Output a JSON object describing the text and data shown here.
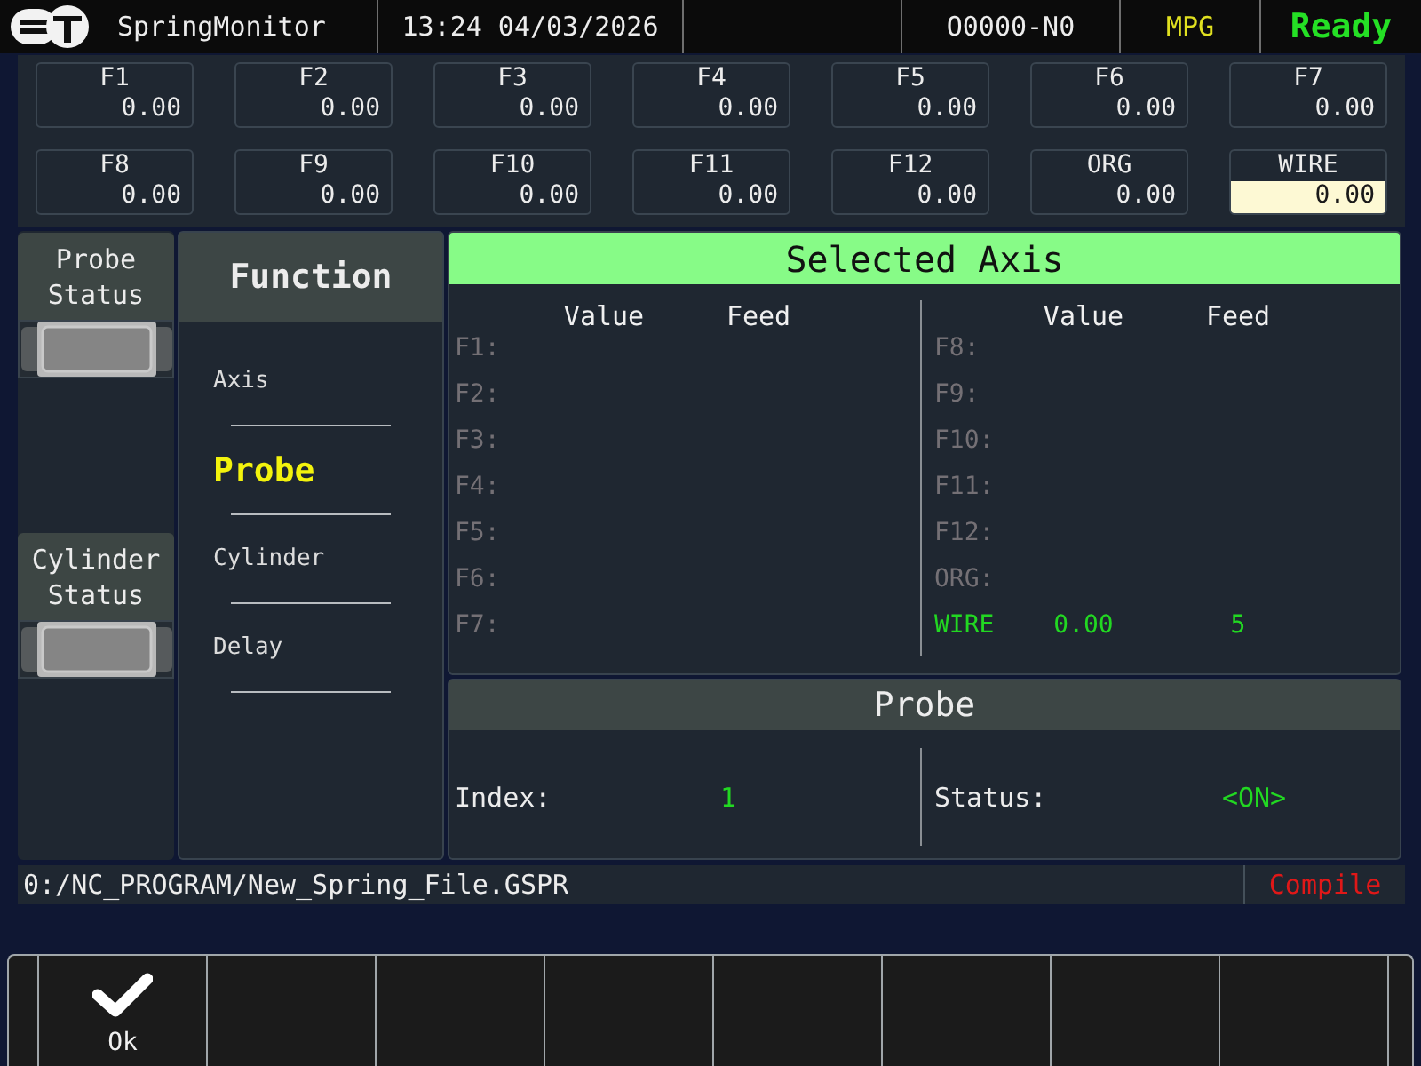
{
  "header": {
    "title": "SpringMonitor",
    "datetime": "13:24 04/03/2026",
    "program": "O0000-N0",
    "mode": "MPG",
    "state": "Ready"
  },
  "axes": [
    {
      "label": "F1",
      "value": "0.00",
      "selected": false
    },
    {
      "label": "F2",
      "value": "0.00",
      "selected": false
    },
    {
      "label": "F3",
      "value": "0.00",
      "selected": false
    },
    {
      "label": "F4",
      "value": "0.00",
      "selected": false
    },
    {
      "label": "F5",
      "value": "0.00",
      "selected": false
    },
    {
      "label": "F6",
      "value": "0.00",
      "selected": false
    },
    {
      "label": "F7",
      "value": "0.00",
      "selected": false
    },
    {
      "label": "F8",
      "value": "0.00",
      "selected": false
    },
    {
      "label": "F9",
      "value": "0.00",
      "selected": false
    },
    {
      "label": "F10",
      "value": "0.00",
      "selected": false
    },
    {
      "label": "F11",
      "value": "0.00",
      "selected": false
    },
    {
      "label": "F12",
      "value": "0.00",
      "selected": false
    },
    {
      "label": "ORG",
      "value": "0.00",
      "selected": false
    },
    {
      "label": "WIRE",
      "value": "0.00",
      "selected": true
    }
  ],
  "status_panels": [
    {
      "title": "Probe Status"
    },
    {
      "title": "Cylinder Status"
    }
  ],
  "function_menu": {
    "title": "Function",
    "items": [
      {
        "label": "Axis",
        "selected": false
      },
      {
        "label": "Probe",
        "selected": true
      },
      {
        "label": "Cylinder",
        "selected": false
      },
      {
        "label": "Delay",
        "selected": false
      }
    ]
  },
  "selected_axis": {
    "title": "Selected Axis",
    "sides": [
      {
        "headers": [
          "Value",
          "Feed"
        ],
        "rows": [
          {
            "label": "F1:",
            "active": false
          },
          {
            "label": "F2:",
            "active": false
          },
          {
            "label": "F3:",
            "active": false
          },
          {
            "label": "F4:",
            "active": false
          },
          {
            "label": "F5:",
            "active": false
          },
          {
            "label": "F6:",
            "active": false
          },
          {
            "label": "F7:",
            "active": false
          }
        ]
      },
      {
        "headers": [
          "Value",
          "Feed"
        ],
        "rows": [
          {
            "label": "F8:",
            "active": false
          },
          {
            "label": "F9:",
            "active": false
          },
          {
            "label": "F10:",
            "active": false
          },
          {
            "label": "F11:",
            "active": false
          },
          {
            "label": "F12:",
            "active": false
          },
          {
            "label": "ORG:",
            "active": false
          },
          {
            "label": "WIRE",
            "active": true,
            "value": "0.00",
            "feed": "5"
          }
        ]
      }
    ]
  },
  "probe": {
    "title": "Probe",
    "fields": [
      {
        "label": "Index:",
        "value": "1"
      },
      {
        "label": "Status:",
        "value": "<ON>"
      }
    ]
  },
  "path_bar": {
    "path": "0:/NC_PROGRAM/New_Spring_File.GSPR",
    "action": "Compile"
  },
  "softkeys": [
    {
      "kind": "confirm",
      "label": "Ok"
    }
  ]
}
